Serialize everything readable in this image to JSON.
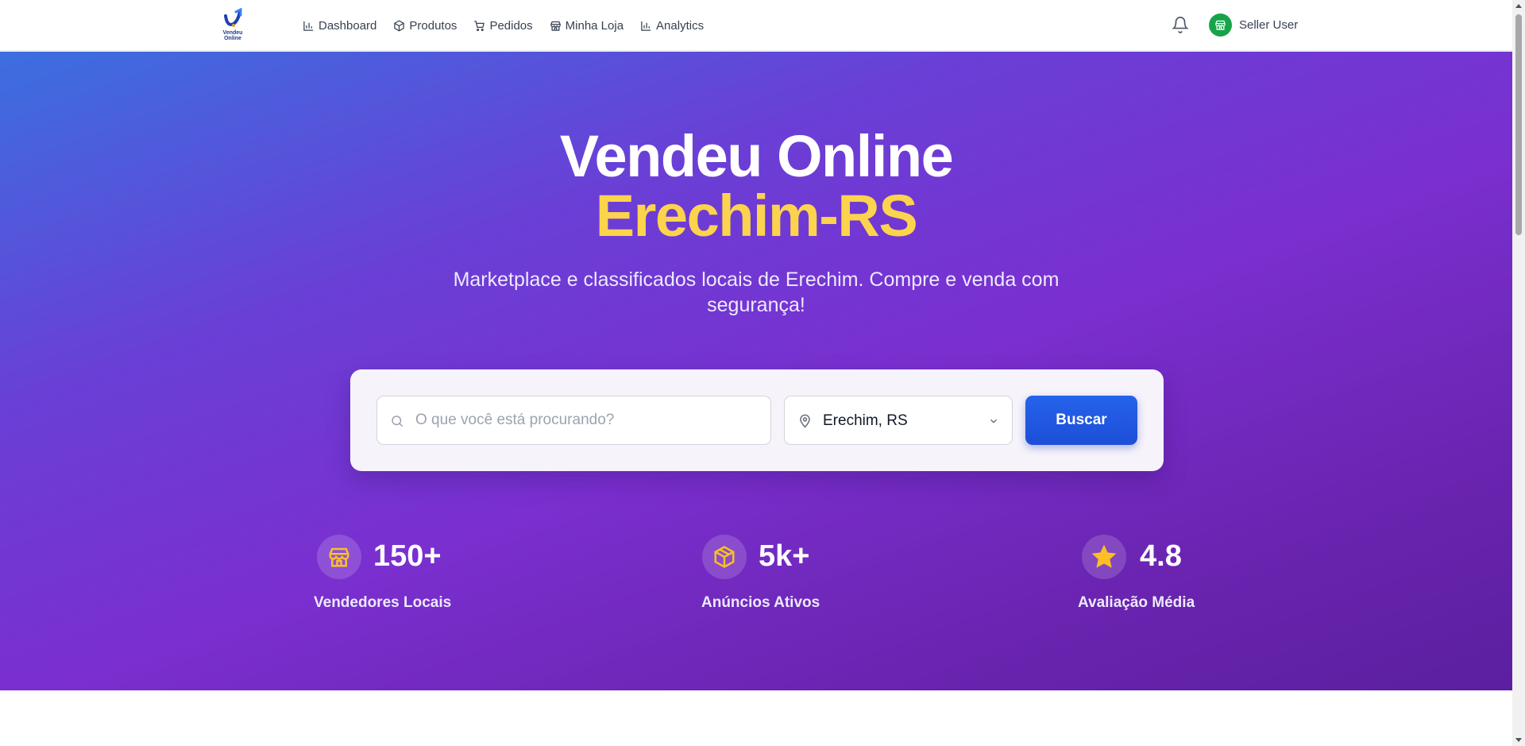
{
  "navbar": {
    "logo": {
      "text_line1": "Vendeu",
      "text_line2": "Online"
    },
    "links": [
      {
        "label": "Dashboard",
        "icon": "bar-chart-icon"
      },
      {
        "label": "Produtos",
        "icon": "package-icon"
      },
      {
        "label": "Pedidos",
        "icon": "cart-icon"
      },
      {
        "label": "Minha Loja",
        "icon": "store-icon"
      },
      {
        "label": "Analytics",
        "icon": "bar-chart-icon"
      }
    ],
    "notifications_icon": "bell-icon",
    "user": {
      "name": "Seller User",
      "avatar_icon": "store-icon",
      "avatar_color": "#16a34a"
    }
  },
  "hero": {
    "title_line1": "Vendeu Online",
    "title_line2": "Erechim-RS",
    "title_accent_color": "#fcd34d",
    "subtitle": "Marketplace e classificados locais de Erechim. Compre e venda com segurança!",
    "search": {
      "placeholder": "O que você está procurando?",
      "value": "",
      "location_value": "Erechim, RS",
      "button_label": "Buscar",
      "button_color": "#2563eb"
    },
    "stats": [
      {
        "value": "150+",
        "label": "Vendedores Locais",
        "icon": "store-icon"
      },
      {
        "value": "5k+",
        "label": "Anúncios Ativos",
        "icon": "package-icon"
      },
      {
        "value": "4.8",
        "label": "Avaliação Média",
        "icon": "star-icon"
      }
    ]
  }
}
